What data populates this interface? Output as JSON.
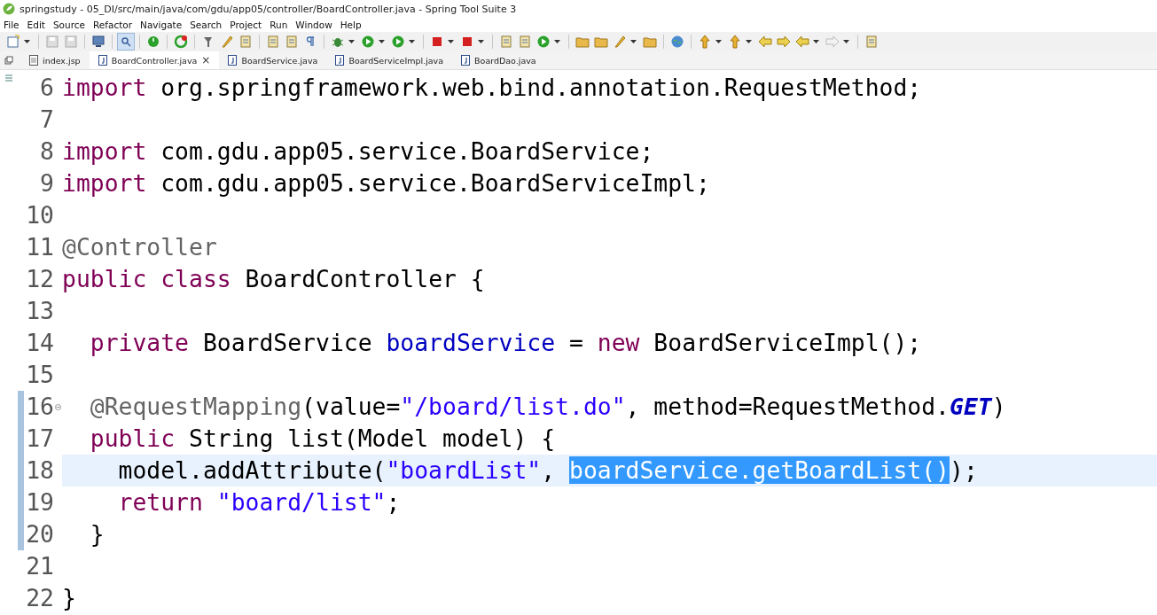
{
  "window": {
    "title": "springstudy - 05_DI/src/main/java/com/gdu/app05/controller/BoardController.java - Spring Tool Suite 3"
  },
  "menu": [
    "File",
    "Edit",
    "Source",
    "Refactor",
    "Navigate",
    "Search",
    "Project",
    "Run",
    "Window",
    "Help"
  ],
  "tabs": [
    {
      "label": "index.jsp",
      "selected": false,
      "kind": "jsp"
    },
    {
      "label": "BoardController.java",
      "selected": true,
      "kind": "java",
      "close": "×"
    },
    {
      "label": "BoardService.java",
      "selected": false,
      "kind": "java"
    },
    {
      "label": "BoardServiceImpl.java",
      "selected": false,
      "kind": "java"
    },
    {
      "label": "BoardDao.java",
      "selected": false,
      "kind": "java"
    }
  ],
  "editor": {
    "lines": [
      {
        "number": "6",
        "tokens": [
          {
            "kind": "keyword",
            "text": "import"
          },
          {
            "kind": "plain",
            "text": " org.springframework.web.bind.annotation.RequestMethod;"
          }
        ]
      },
      {
        "number": "7"
      },
      {
        "number": "8",
        "tokens": [
          {
            "kind": "keyword",
            "text": "import"
          },
          {
            "kind": "plain",
            "text": " com.gdu.app05.service.BoardService;"
          }
        ]
      },
      {
        "number": "9",
        "tokens": [
          {
            "kind": "keyword",
            "text": "import"
          },
          {
            "kind": "plain",
            "text": " com.gdu.app05.service.BoardServiceImpl;"
          }
        ]
      },
      {
        "number": "10"
      },
      {
        "number": "11",
        "tokens": [
          {
            "kind": "annotation",
            "text": "@Controller"
          }
        ]
      },
      {
        "number": "12",
        "tokens": [
          {
            "kind": "keyword",
            "text": "public"
          },
          {
            "kind": "keyword",
            "text": " class"
          },
          {
            "kind": "plain",
            "text": " BoardController {"
          }
        ]
      },
      {
        "number": "13"
      },
      {
        "number": "14",
        "tokens": [
          {
            "kind": "keyword",
            "text": "  private"
          },
          {
            "kind": "plain",
            "text": " BoardService "
          },
          {
            "kind": "field",
            "text": "boardService"
          },
          {
            "kind": "plain",
            "text": " = "
          },
          {
            "kind": "keyword",
            "text": "new"
          },
          {
            "kind": "plain",
            "text": " BoardServiceImpl();"
          }
        ]
      },
      {
        "number": "15"
      },
      {
        "number": "16",
        "changed": true,
        "foldable": true,
        "tokens": [
          {
            "kind": "annotation",
            "text": "  @RequestMapping"
          },
          {
            "kind": "plain",
            "text": "(value="
          },
          {
            "kind": "string",
            "text": "\"/board/list.do\""
          },
          {
            "kind": "plain",
            "text": ", method=RequestMethod."
          },
          {
            "kind": "constant",
            "text": "GET"
          },
          {
            "kind": "plain",
            "text": ")"
          }
        ]
      },
      {
        "number": "17",
        "changed": true,
        "tokens": [
          {
            "kind": "keyword",
            "text": "  public"
          },
          {
            "kind": "plain",
            "text": " String list(Model model) {"
          }
        ]
      },
      {
        "number": "18",
        "changed": true,
        "current": true,
        "tokens": [
          {
            "kind": "plain",
            "text": "    model.addAttribute("
          },
          {
            "kind": "string",
            "text": "\"boardList\""
          },
          {
            "kind": "plain",
            "text": ", "
          },
          {
            "kind": "selected",
            "text": "boardService.getBoardList()"
          },
          {
            "kind": "plain",
            "text": ");"
          }
        ]
      },
      {
        "number": "19",
        "changed": true,
        "tokens": [
          {
            "kind": "keyword",
            "text": "    return"
          },
          {
            "kind": "string",
            "text": " \"board/list\""
          },
          {
            "kind": "plain",
            "text": ";"
          }
        ]
      },
      {
        "number": "20",
        "changed": true,
        "tokens": [
          {
            "kind": "plain",
            "text": "  }"
          }
        ]
      },
      {
        "number": "21"
      },
      {
        "number": "22",
        "tokens": [
          {
            "kind": "plain",
            "text": "}"
          }
        ]
      }
    ]
  }
}
